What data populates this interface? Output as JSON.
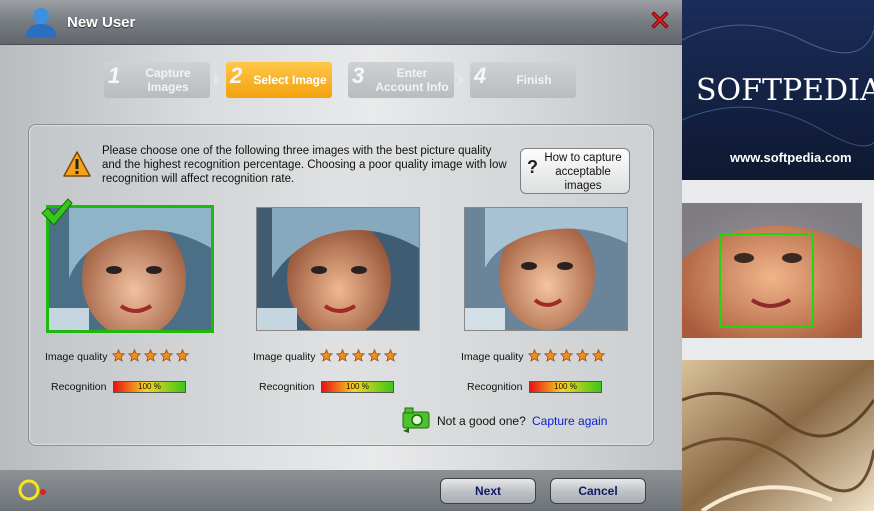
{
  "window": {
    "title": "New User"
  },
  "steps": [
    {
      "num": "1",
      "label": "Capture Images",
      "active": false
    },
    {
      "num": "2",
      "label": "Select Image",
      "active": true
    },
    {
      "num": "3",
      "label": "Enter Account Info",
      "active": false
    },
    {
      "num": "4",
      "label": "Finish",
      "active": false
    }
  ],
  "instructions": "Please choose one of the following three images with the best picture quality and the highest recognition percentage. Choosing a poor quality image with low recognition will affect recognition rate.",
  "howto_button": "How to capture acceptable images",
  "candidates": [
    {
      "quality_label": "Image quality",
      "stars": 5,
      "recognition_label": "Recognition",
      "recognition": "100 %",
      "selected": true
    },
    {
      "quality_label": "Image quality",
      "stars": 5,
      "recognition_label": "Recognition",
      "recognition": "100 %",
      "selected": false
    },
    {
      "quality_label": "Image quality",
      "stars": 5,
      "recognition_label": "Recognition",
      "recognition": "100 %",
      "selected": false
    }
  ],
  "not_good_text": "Not a good one?",
  "capture_again_link": "Capture again",
  "buttons": {
    "next": "Next",
    "cancel": "Cancel"
  },
  "background": {
    "brand": "SOFTPEDIA",
    "url": "www.softpedia.com"
  },
  "colors": {
    "accent_step": "#f3a10f",
    "selection": "#1fb80f",
    "link": "#0d1fd6"
  }
}
